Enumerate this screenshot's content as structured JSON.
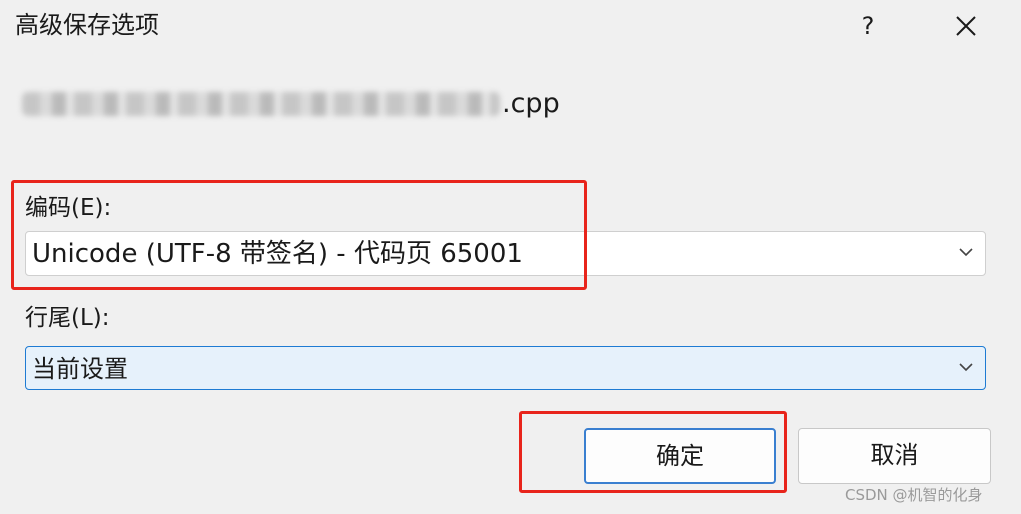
{
  "window": {
    "title": "高级保存选项",
    "help_label": "?"
  },
  "file": {
    "extension": ".cpp"
  },
  "encoding": {
    "label": "编码(E):",
    "value": "Unicode (UTF-8 带签名) - 代码页 65001"
  },
  "line_endings": {
    "label": "行尾(L):",
    "value": "当前设置"
  },
  "buttons": {
    "ok_label": "确定",
    "cancel_label": "取消"
  },
  "watermark": "CSDN @机智的化身",
  "colors": {
    "highlight_box": "#e8241b",
    "focus_border": "#1e7bd3",
    "primary_button_border": "#3a7fd0"
  }
}
